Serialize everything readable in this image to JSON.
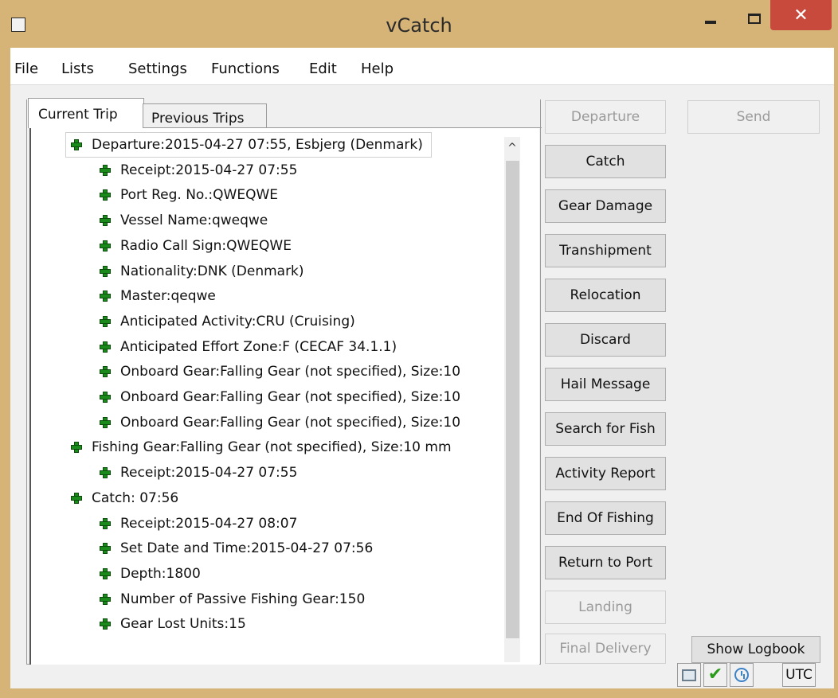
{
  "window": {
    "title": "vCatch",
    "close_glyph": "✕"
  },
  "menu": [
    "File",
    "Lists",
    "Settings",
    "Functions",
    "Edit",
    "Help"
  ],
  "tabs": {
    "current": "Current Trip",
    "previous": "Previous Trips"
  },
  "tree": [
    {
      "level": 0,
      "text": "Departure:2015-04-27 07:55,  Esbjerg (Denmark)"
    },
    {
      "level": 1,
      "text": "Receipt:2015-04-27 07:55"
    },
    {
      "level": 1,
      "text": "Port Reg. No.:QWEQWE"
    },
    {
      "level": 1,
      "text": "Vessel Name:qweqwe"
    },
    {
      "level": 1,
      "text": "Radio Call Sign:QWEQWE"
    },
    {
      "level": 1,
      "text": "Nationality:DNK (Denmark)"
    },
    {
      "level": 1,
      "text": "Master:qeqwe"
    },
    {
      "level": 1,
      "text": "Anticipated Activity:CRU (Cruising)"
    },
    {
      "level": 1,
      "text": "Anticipated Effort Zone:F (CECAF 34.1.1)"
    },
    {
      "level": 1,
      "text": "Onboard Gear:Falling Gear (not specified), Size:10"
    },
    {
      "level": 1,
      "text": "Onboard Gear:Falling Gear (not specified), Size:10"
    },
    {
      "level": 1,
      "text": "Onboard Gear:Falling Gear (not specified), Size:10"
    },
    {
      "level": 0,
      "text": "Fishing Gear:Falling Gear (not specified), Size:10 mm"
    },
    {
      "level": 1,
      "text": "Receipt:2015-04-27 07:55"
    },
    {
      "level": 0,
      "text": "Catch: 07:56"
    },
    {
      "level": 1,
      "text": "Receipt:2015-04-27 08:07"
    },
    {
      "level": 1,
      "text": "Set Date and Time:2015-04-27 07:56"
    },
    {
      "level": 1,
      "text": "Depth:1800"
    },
    {
      "level": 1,
      "text": "Number of Passive Fishing Gear:150"
    },
    {
      "level": 1,
      "text": "Gear Lost Units:15"
    }
  ],
  "scroll_up_glyph": "^",
  "buttons": {
    "departure": "Departure",
    "send": "Send",
    "catch": "Catch",
    "gear_damage": "Gear Damage",
    "transhipment": "Transhipment",
    "relocation": "Relocation",
    "discard": "Discard",
    "hail_message": "Hail Message",
    "search_for_fish": "Search for Fish",
    "activity_report": "Activity Report",
    "end_of_fishing": "End Of Fishing",
    "return_to_port": "Return to Port",
    "landing": "Landing",
    "final_delivery": "Final Delivery",
    "show_logbook": "Show Logbook"
  },
  "status": {
    "check_glyph": "✔",
    "utc": "UTC"
  },
  "icons": [
    "app-icon",
    "plus-icon",
    "monitor-icon",
    "check-icon",
    "clock-icon"
  ]
}
